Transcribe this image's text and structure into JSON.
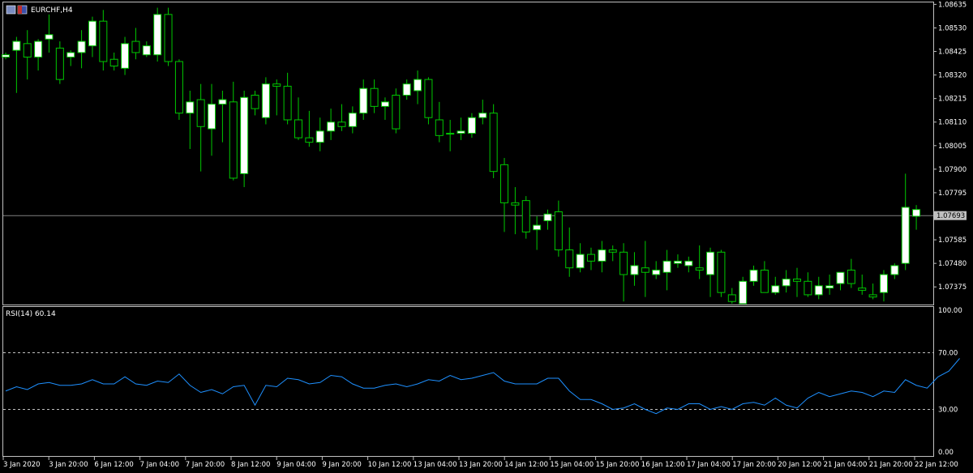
{
  "symbol_title": "EURCHF,H4",
  "colors": {
    "background": "#000000",
    "frame": "#c0c0c0",
    "bull_body": "#ffffff",
    "bear_body": "#000000",
    "wick": "#00c800",
    "rsi_line": "#1e90ff",
    "level_line": "#c0c0c0",
    "bid_line": "#808080",
    "price_tag_bg": "#c0c0c0",
    "price_tag_text": "#000000"
  },
  "chart_data": [
    {
      "type": "candlestick",
      "symbol": "EURCHF",
      "timeframe": "H4",
      "price_ticks": [
        "1.08635",
        "1.08530",
        "1.08425",
        "1.08320",
        "1.08215",
        "1.08110",
        "1.08005",
        "1.07900",
        "1.07795",
        "1.07693",
        "1.07585",
        "1.07480",
        "1.07375"
      ],
      "ylim": [
        1.073,
        1.0864
      ],
      "current_price": "1.07693",
      "ohlc": [
        [
          1.084,
          1.0842,
          1.0839,
          1.0841
        ],
        [
          1.0843,
          1.0849,
          1.0824,
          1.0847
        ],
        [
          1.0846,
          1.0852,
          1.083,
          1.084
        ],
        [
          1.084,
          1.0848,
          1.0834,
          1.0847
        ],
        [
          1.0848,
          1.0859,
          1.0842,
          1.085
        ],
        [
          1.0844,
          1.0847,
          1.0828,
          1.083
        ],
        [
          1.084,
          1.0843,
          1.0836,
          1.0842
        ],
        [
          1.0842,
          1.0852,
          1.0835,
          1.0847
        ],
        [
          1.0845,
          1.0858,
          1.084,
          1.0856
        ],
        [
          1.0856,
          1.0861,
          1.0834,
          1.0838
        ],
        [
          1.0839,
          1.0842,
          1.0834,
          1.0836
        ],
        [
          1.0835,
          1.0849,
          1.0832,
          1.0846
        ],
        [
          1.0847,
          1.0853,
          1.0839,
          1.0842
        ],
        [
          1.0841,
          1.0847,
          1.084,
          1.0845
        ],
        [
          1.0841,
          1.0862,
          1.0838,
          1.0859
        ],
        [
          1.0859,
          1.0862,
          1.0836,
          1.0838
        ],
        [
          1.0838,
          1.0839,
          1.0812,
          1.0815
        ],
        [
          1.0815,
          1.0825,
          1.0799,
          1.082
        ],
        [
          1.0821,
          1.0828,
          1.0789,
          1.0809
        ],
        [
          1.0808,
          1.0828,
          1.0796,
          1.0819
        ],
        [
          1.0819,
          1.0825,
          1.0802,
          1.0821
        ],
        [
          1.082,
          1.0829,
          1.0785,
          1.0786
        ],
        [
          1.0788,
          1.0825,
          1.0782,
          1.0822
        ],
        [
          1.0823,
          1.0825,
          1.0814,
          1.0817
        ],
        [
          1.0813,
          1.0831,
          1.081,
          1.0828
        ],
        [
          1.0828,
          1.083,
          1.0814,
          1.0827
        ],
        [
          1.0827,
          1.0833,
          1.081,
          1.0812
        ],
        [
          1.0812,
          1.0822,
          1.0803,
          1.0804
        ],
        [
          1.0804,
          1.0816,
          1.08,
          1.0802
        ],
        [
          1.0802,
          1.0813,
          1.0798,
          1.0807
        ],
        [
          1.0807,
          1.0817,
          1.0803,
          1.0811
        ],
        [
          1.0811,
          1.0819,
          1.0807,
          1.0809
        ],
        [
          1.0809,
          1.0818,
          1.0806,
          1.0815
        ],
        [
          1.0815,
          1.083,
          1.0812,
          1.0826
        ],
        [
          1.0826,
          1.083,
          1.0815,
          1.0818
        ],
        [
          1.0818,
          1.0822,
          1.0812,
          1.082
        ],
        [
          1.0823,
          1.0826,
          1.0806,
          1.0808
        ],
        [
          1.0823,
          1.083,
          1.0821,
          1.0828
        ],
        [
          1.0825,
          1.0834,
          1.0819,
          1.083
        ],
        [
          1.083,
          1.0831,
          1.081,
          1.0813
        ],
        [
          1.0812,
          1.082,
          1.0802,
          1.0805
        ],
        [
          1.0806,
          1.0812,
          1.0798,
          1.0806
        ],
        [
          1.0806,
          1.0813,
          1.0803,
          1.0807
        ],
        [
          1.0806,
          1.0815,
          1.0804,
          1.0813
        ],
        [
          1.0813,
          1.0821,
          1.081,
          1.0815
        ],
        [
          1.0815,
          1.0819,
          1.0786,
          1.0789
        ],
        [
          1.0792,
          1.0795,
          1.0762,
          1.0775
        ],
        [
          1.0775,
          1.0782,
          1.0761,
          1.0774
        ],
        [
          1.0776,
          1.0778,
          1.0759,
          1.0762
        ],
        [
          1.0763,
          1.0769,
          1.0754,
          1.0765
        ],
        [
          1.0767,
          1.0772,
          1.0763,
          1.077
        ],
        [
          1.0771,
          1.0776,
          1.0751,
          1.0754
        ],
        [
          1.0754,
          1.0764,
          1.0742,
          1.0746
        ],
        [
          1.0746,
          1.0757,
          1.0744,
          1.0752
        ],
        [
          1.0752,
          1.0755,
          1.0745,
          1.0749
        ],
        [
          1.0749,
          1.0758,
          1.0744,
          1.0754
        ],
        [
          1.0754,
          1.0756,
          1.0749,
          1.0753
        ],
        [
          1.0753,
          1.0757,
          1.0731,
          1.0743
        ],
        [
          1.0743,
          1.0753,
          1.0738,
          1.0747
        ],
        [
          1.0746,
          1.0758,
          1.0733,
          1.0744
        ],
        [
          1.0743,
          1.0749,
          1.0741,
          1.0745
        ],
        [
          1.0744,
          1.0754,
          1.0736,
          1.0749
        ],
        [
          1.0748,
          1.0752,
          1.0746,
          1.0749
        ],
        [
          1.0747,
          1.0751,
          1.0744,
          1.0749
        ],
        [
          1.0746,
          1.0756,
          1.0741,
          1.0745
        ],
        [
          1.0743,
          1.0755,
          1.0733,
          1.0753
        ],
        [
          1.0753,
          1.0754,
          1.0733,
          1.0735
        ],
        [
          1.0734,
          1.0737,
          1.073,
          1.0731
        ],
        [
          1.073,
          1.0742,
          1.073,
          1.074
        ],
        [
          1.074,
          1.0747,
          1.0738,
          1.0745
        ],
        [
          1.0745,
          1.0749,
          1.0735,
          1.0735
        ],
        [
          1.0735,
          1.0742,
          1.0734,
          1.0738
        ],
        [
          1.0738,
          1.0745,
          1.0735,
          1.0741
        ],
        [
          1.0741,
          1.0746,
          1.0733,
          1.074
        ],
        [
          1.074,
          1.0744,
          1.0733,
          1.0734
        ],
        [
          1.0734,
          1.0742,
          1.0732,
          1.0738
        ],
        [
          1.0737,
          1.0743,
          1.0734,
          1.0738
        ],
        [
          1.0739,
          1.0744,
          1.0736,
          1.0744
        ],
        [
          1.0745,
          1.075,
          1.0737,
          1.0739
        ],
        [
          1.0737,
          1.0743,
          1.0734,
          1.0736
        ],
        [
          1.0734,
          1.0739,
          1.0732,
          1.0733
        ],
        [
          1.0735,
          1.0745,
          1.0731,
          1.0743
        ],
        [
          1.0743,
          1.0748,
          1.0741,
          1.0747
        ],
        [
          1.0748,
          1.0788,
          1.0745,
          1.0773
        ],
        [
          1.0769,
          1.0774,
          1.0763,
          1.0772
        ]
      ],
      "x_tick_labels": [
        "3 Jan 2020",
        "3 Jan 20:00",
        "6 Jan 12:00",
        "7 Jan 04:00",
        "7 Jan 20:00",
        "8 Jan 12:00",
        "9 Jan 04:00",
        "9 Jan 20:00",
        "10 Jan 12:00",
        "13 Jan 04:00",
        "13 Jan 20:00",
        "14 Jan 12:00",
        "15 Jan 04:00",
        "15 Jan 20:00",
        "16 Jan 12:00",
        "17 Jan 04:00",
        "17 Jan 20:00",
        "20 Jan 12:00",
        "21 Jan 04:00",
        "21 Jan 20:00",
        "22 Jan 12:00"
      ]
    },
    {
      "type": "line",
      "title": "RSI(14) 60.14",
      "ylim": [
        0,
        100
      ],
      "y_ticks": [
        "100.00",
        "70.00",
        "30.00",
        "0.00"
      ],
      "levels": [
        70,
        30
      ],
      "values": [
        43,
        46,
        44,
        48,
        49,
        47,
        47,
        48,
        51,
        48,
        48,
        53,
        48,
        47,
        50,
        49,
        55,
        47,
        42,
        44,
        41,
        46,
        47,
        33,
        47,
        46,
        52,
        51,
        48,
        49,
        54,
        53,
        48,
        45,
        45,
        47,
        48,
        46,
        48,
        51,
        50,
        54,
        51,
        52,
        54,
        56,
        50,
        48,
        48,
        48,
        52,
        52,
        43,
        37,
        37,
        34,
        30,
        31,
        34,
        30,
        27,
        31,
        30,
        34,
        34,
        30,
        32,
        30,
        34,
        35,
        33,
        38,
        33,
        31,
        38,
        42,
        39,
        41,
        43,
        42,
        39,
        43,
        42,
        51,
        47,
        45,
        53,
        57,
        66
      ]
    }
  ]
}
